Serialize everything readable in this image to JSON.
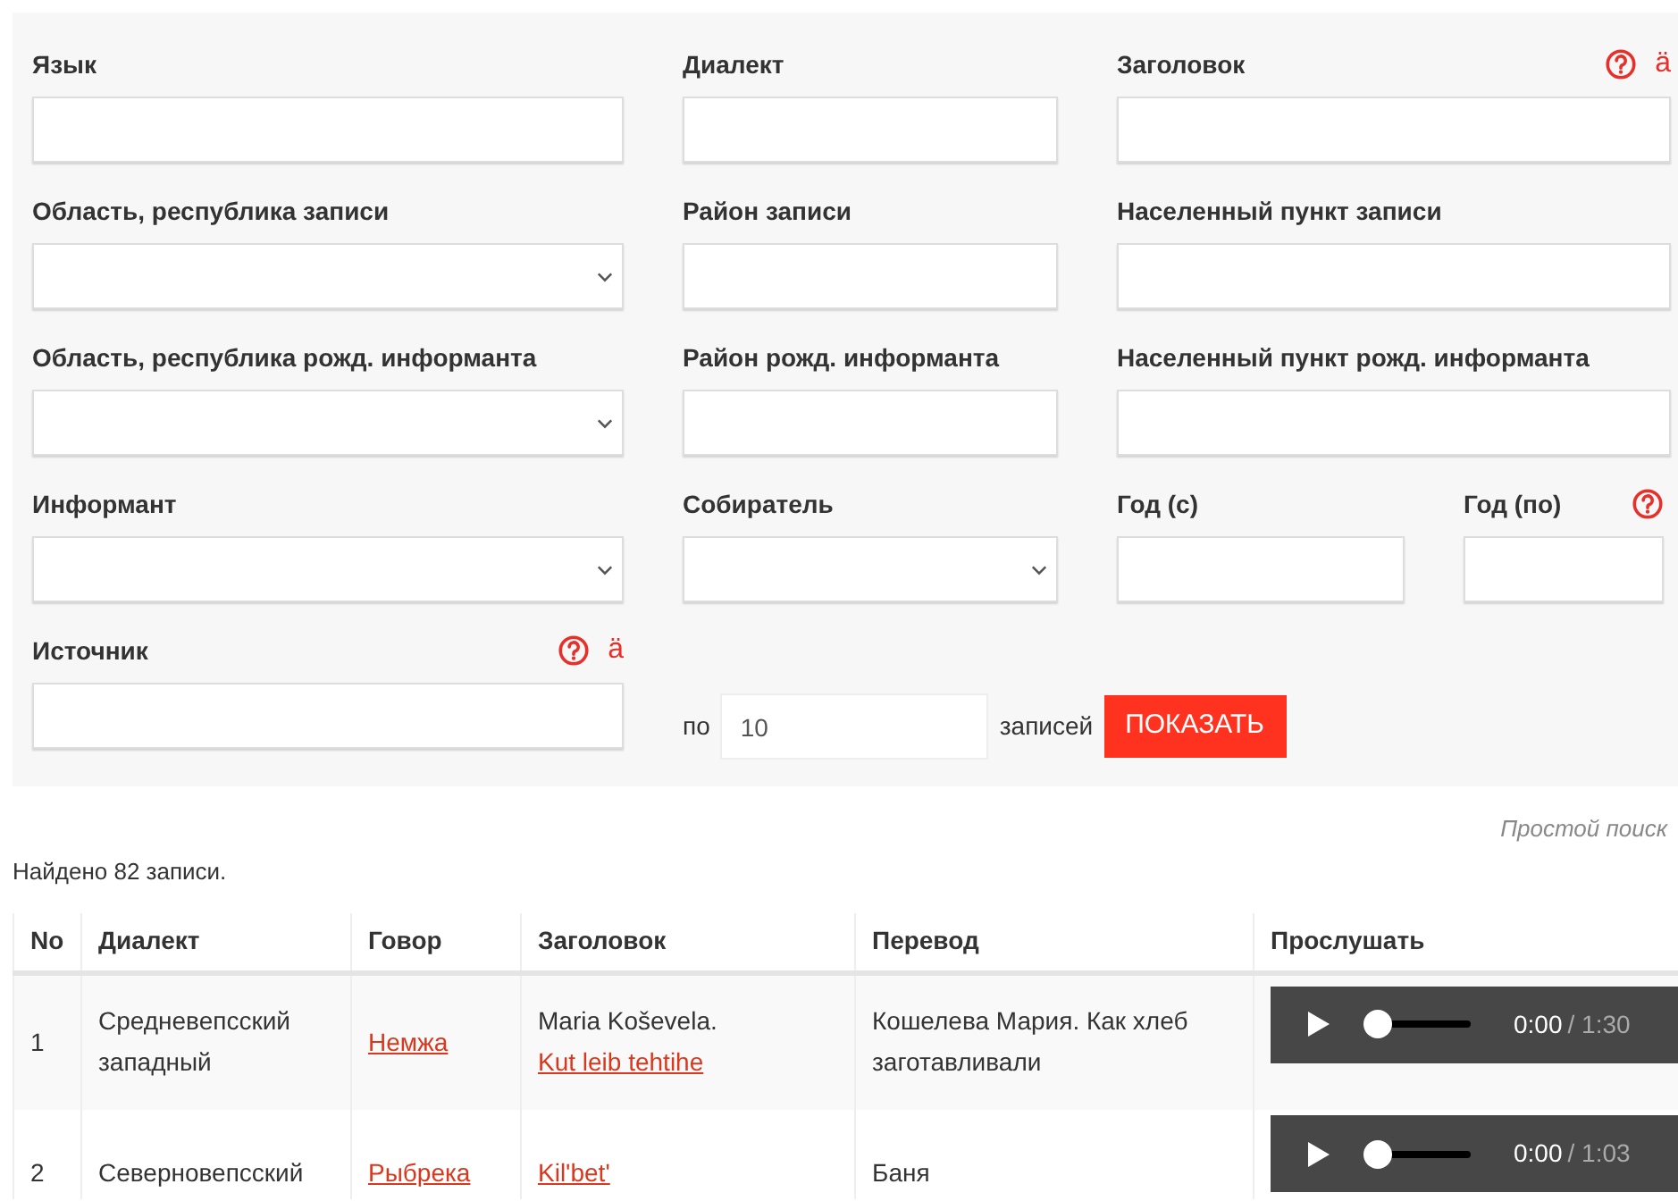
{
  "form": {
    "rows": [
      [
        {
          "label": "Язык",
          "kind": "text"
        },
        {
          "label": "Диалект",
          "kind": "text"
        },
        {
          "label": "Заголовок",
          "kind": "text",
          "help": true,
          "char_button": "ä"
        }
      ],
      [
        {
          "label": "Область, республика записи",
          "kind": "select"
        },
        {
          "label": "Район записи",
          "kind": "text"
        },
        {
          "label": "Населенный пункт записи",
          "kind": "text"
        }
      ],
      [
        {
          "label": "Область, республика рожд. информанта",
          "kind": "select"
        },
        {
          "label": "Район рожд. информанта",
          "kind": "text"
        },
        {
          "label": "Населенный пункт рожд. информанта",
          "kind": "text"
        }
      ],
      [
        {
          "label": "Информант",
          "kind": "select"
        },
        {
          "label": "Собиратель",
          "kind": "select"
        },
        {
          "label": "Год (с)",
          "kind": "text"
        },
        {
          "label": "Год (по)",
          "kind": "text",
          "help": true
        }
      ],
      [
        {
          "label": "Источник",
          "kind": "text",
          "help": true,
          "char_button": "ä"
        }
      ]
    ],
    "per_page": {
      "prefix": "по",
      "value": "10",
      "suffix": "записей"
    },
    "submit": "ПОКАЗАТЬ"
  },
  "simple_search_link": "Простой поиск",
  "found_text": "Найдено 82 записи.",
  "table": {
    "columns": [
      "No",
      "Диалект",
      "Говор",
      "Заголовок",
      "Перевод",
      "Прослушать"
    ],
    "rows": [
      {
        "no": "1",
        "dialect": "Средневепсский западный",
        "subdialect": "Немжа",
        "title_prefix": "Maria Koševela.",
        "title_link": "Kut leib tehtihe",
        "translation": "Кошелева Мария. Как хлеб заготавливали",
        "audio": {
          "level": 0,
          "current": "0:00",
          "duration": "/ 1:30"
        }
      },
      {
        "no": "2",
        "dialect": "Северновепсский",
        "subdialect": "Рыбрека",
        "title_link": "Kil'bet'",
        "translation": "Баня",
        "audio": {
          "level": 0,
          "current": "0:00",
          "duration": "/ 1:03"
        }
      }
    ]
  }
}
